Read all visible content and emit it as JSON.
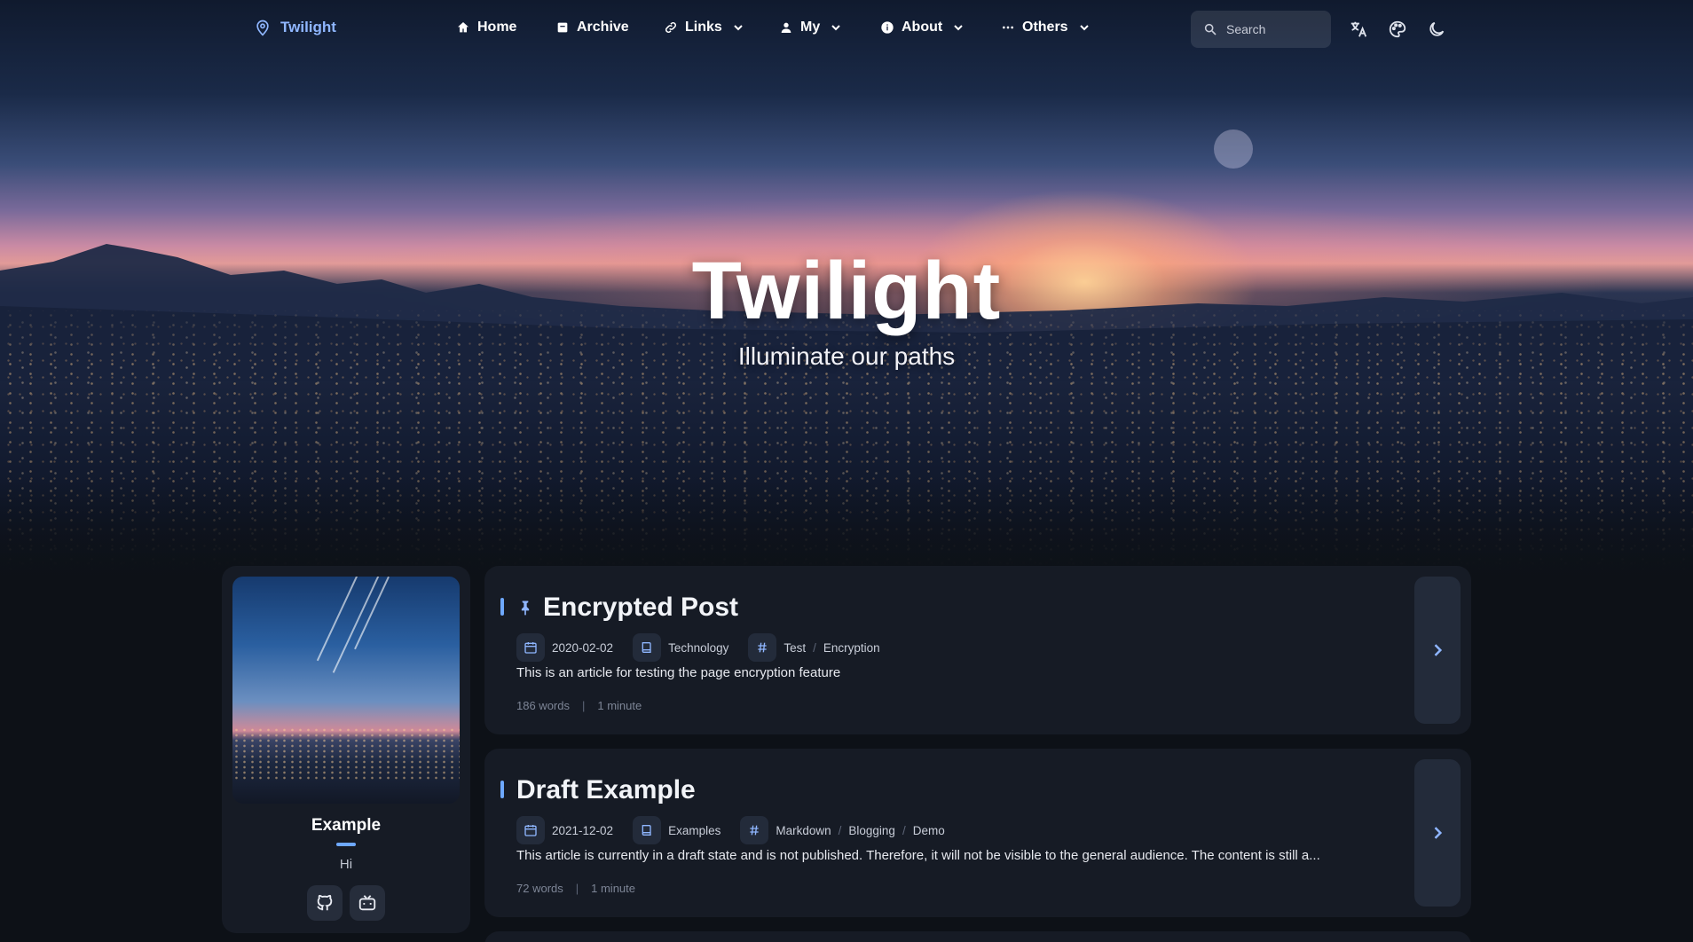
{
  "nav": {
    "brand": "Twilight",
    "items": [
      {
        "label": "Home",
        "icon": "home-icon"
      },
      {
        "label": "Archive",
        "icon": "archive-icon"
      },
      {
        "label": "Links",
        "icon": "link-icon",
        "dropdown": true
      },
      {
        "label": "My",
        "icon": "user-icon",
        "dropdown": true
      },
      {
        "label": "About",
        "icon": "info-icon",
        "dropdown": true
      },
      {
        "label": "Others",
        "icon": "more-icon",
        "dropdown": true
      }
    ],
    "search_placeholder": "Search",
    "right_icons": [
      "translate-icon",
      "palette-icon",
      "dark-mode-icon"
    ]
  },
  "hero": {
    "title": "Twilight",
    "subtitle": "Illuminate our paths"
  },
  "profile": {
    "name": "Example",
    "bio": "Hi",
    "social": [
      "github-icon",
      "bilibili-icon"
    ]
  },
  "posts": [
    {
      "title": "Encrypted Post",
      "pinned": true,
      "date": "2020-02-02",
      "category": "Technology",
      "tags": [
        "Test",
        "Encryption"
      ],
      "description": "This is an article for testing the page encryption feature",
      "words": "186 words",
      "time": "1 minute"
    },
    {
      "title": "Draft Example",
      "pinned": false,
      "date": "2021-12-02",
      "category": "Examples",
      "tags": [
        "Markdown",
        "Blogging",
        "Demo"
      ],
      "description": "This article is currently in a draft state and is not published. Therefore, it will not be visible to the general audience. The content is still a...",
      "words": "72 words",
      "time": "1 minute"
    }
  ],
  "colors": {
    "accent": "#6ea8ff",
    "card": "#161b25",
    "background": "#0d1117"
  }
}
